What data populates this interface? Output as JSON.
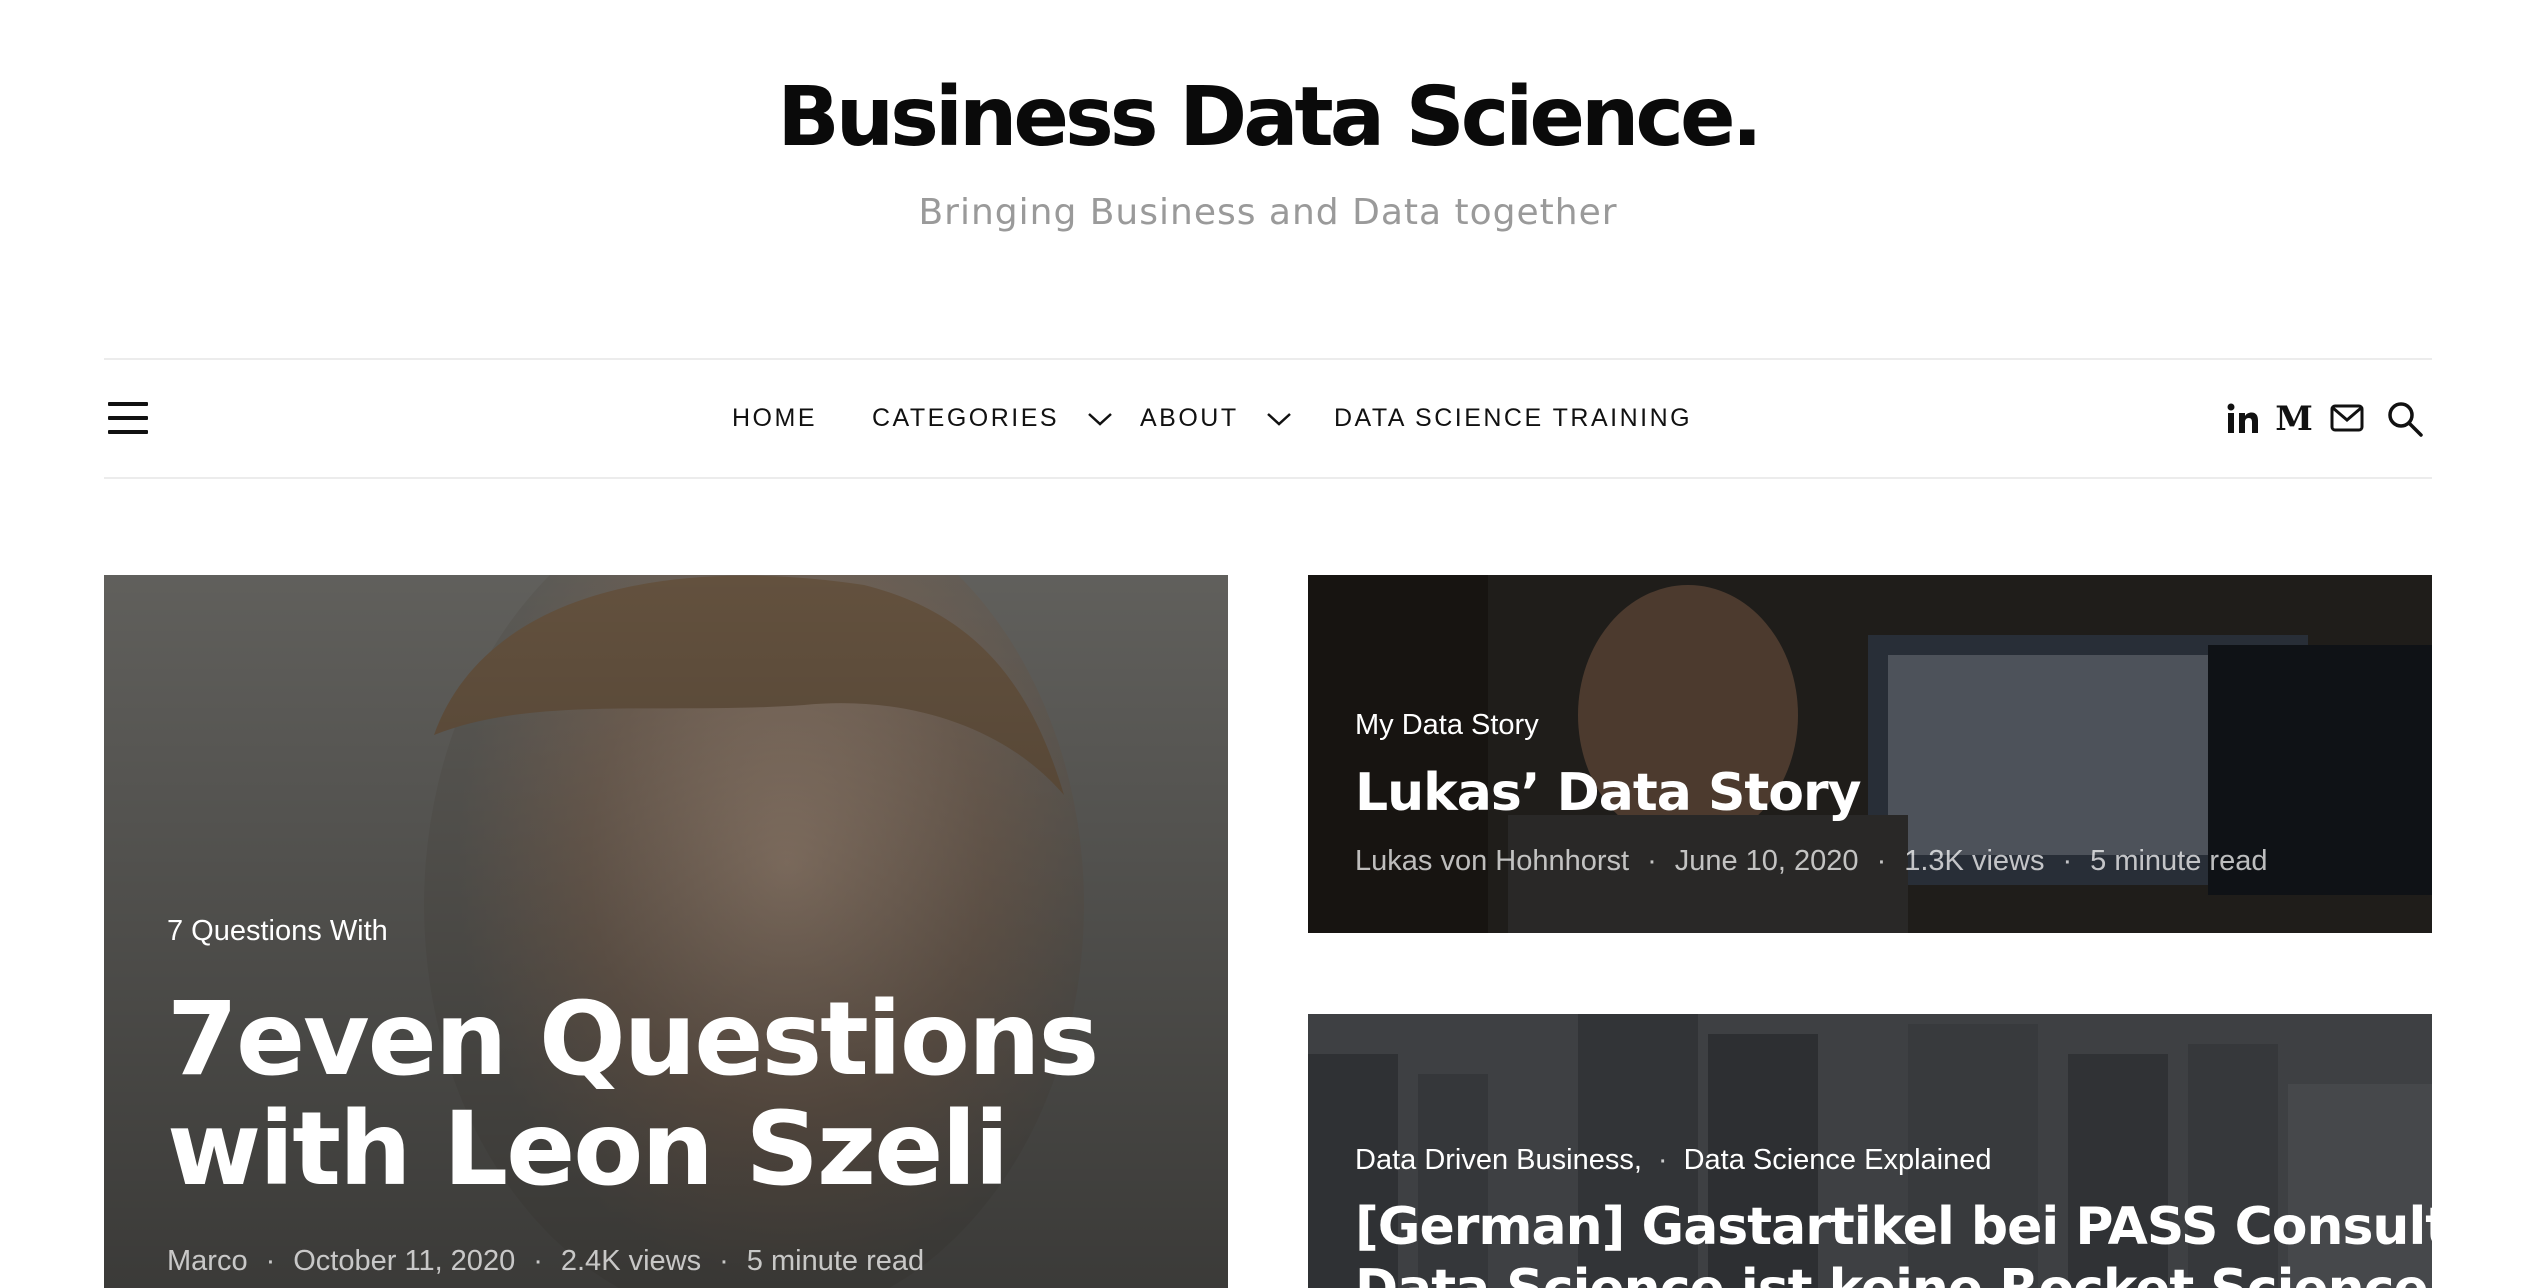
{
  "site": {
    "title": "Business Data Science.",
    "tagline": "Bringing Business and Data together"
  },
  "nav": {
    "items": [
      {
        "label": "HOME",
        "has_dropdown": false
      },
      {
        "label": "CATEGORIES",
        "has_dropdown": true
      },
      {
        "label": "ABOUT",
        "has_dropdown": true
      },
      {
        "label": "DATA SCIENCE TRAINING",
        "has_dropdown": false
      }
    ],
    "social_icons": [
      "linkedin-icon",
      "medium-icon",
      "mail-icon"
    ],
    "search_icon": "search-icon",
    "menu_icon": "hamburger-icon"
  },
  "posts": [
    {
      "category": "7 Questions With",
      "title_line1": "7even Questions",
      "title_line2": "with Leon Szeli",
      "author": "Marco",
      "date": "October 11, 2020",
      "views": "2.4K views",
      "read_time": "5 minute read"
    },
    {
      "category": "My Data Story",
      "title": "Lukas’ Data Story",
      "author": "Lukas von Hohnhorst",
      "date": "June 10, 2020",
      "views": "1.3K views",
      "read_time": "5 minute read"
    },
    {
      "category1": "Data Driven Business,",
      "category2": "Data Science Explained",
      "title_line1": "[German] Gastartikel bei PASS Consulting:",
      "title_line2": "Data Science ist keine Rocket Science – ein"
    }
  ],
  "colors": {
    "text_dark": "#111111",
    "tagline": "#9a9a9a",
    "divider": "#ececec",
    "overlay_text": "#ffffff"
  }
}
